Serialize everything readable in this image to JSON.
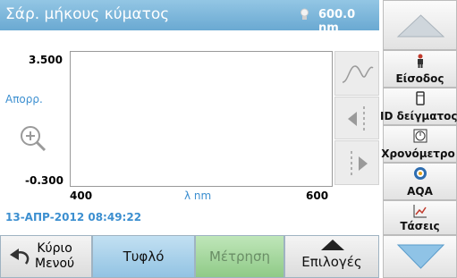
{
  "header": {
    "title": "Σάρ. μήκους κύματος",
    "wavelength": "600.0 nm"
  },
  "graph": {
    "y_max": "3.500",
    "y_min": "-0.300",
    "y_axis_label": "Απορρ.",
    "x_min": "400",
    "x_max": "600",
    "x_axis_label": "λ nm"
  },
  "timestamp": "13-ΑΠΡ-2012  08:49:22",
  "right_panel": {
    "items": [
      {
        "label": "Είσοδος",
        "icon": "user-icon"
      },
      {
        "label": "ID δείγματος",
        "icon": "sample-vial-icon"
      },
      {
        "label": "Χρονόμετρο",
        "icon": "timer-icon"
      },
      {
        "label": "AQA",
        "icon": "aqa-icon"
      },
      {
        "label": "Τάσεις",
        "icon": "trend-chart-icon"
      }
    ]
  },
  "bottom": {
    "main_menu": "Κύριο Μενού",
    "main_menu_line1": "Κύριο",
    "main_menu_line2": "Μενού",
    "blank": "Τυφλό",
    "measure": "Μέτρηση",
    "options": "Επιλογές"
  },
  "colors": {
    "title_bar": "#7cb6dc",
    "accent_blue": "#3c8fd0",
    "blank_button": "#a8d0ea",
    "measure_button": "#a6d6a0"
  }
}
